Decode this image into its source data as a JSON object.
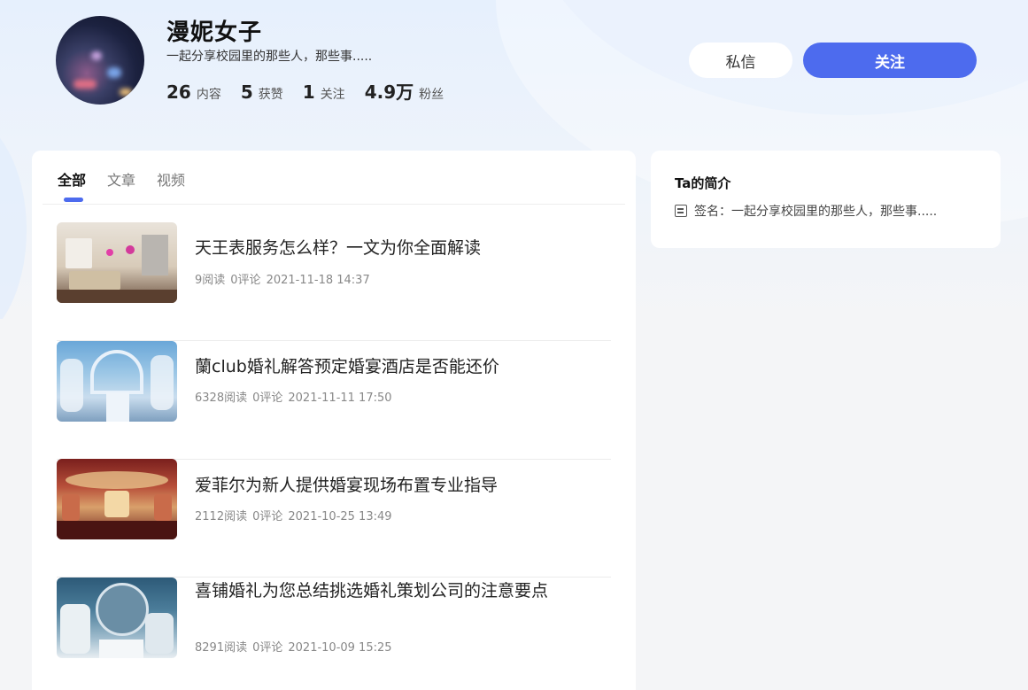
{
  "profile": {
    "name": "漫妮女子",
    "bio": "一起分享校园里的那些人，那些事.....",
    "stats": [
      {
        "num": "26",
        "label": "内容"
      },
      {
        "num": "5",
        "label": "获赞"
      },
      {
        "num": "1",
        "label": "关注"
      },
      {
        "num": "4.9万",
        "label": "粉丝"
      }
    ]
  },
  "actions": {
    "message_label": "私信",
    "follow_label": "关注",
    "follow_color": "#4d6bee"
  },
  "tabs": [
    {
      "label": "全部",
      "active": true
    },
    {
      "label": "文章",
      "active": false
    },
    {
      "label": "视频",
      "active": false
    }
  ],
  "articles": [
    {
      "title": "天王表服务怎么样？一文为你全面解读",
      "reads": "9阅读",
      "comments": "0评论",
      "date": "2021-11-18 14:37"
    },
    {
      "title": "蘭club婚礼解答预定婚宴酒店是否能还价",
      "reads": "6328阅读",
      "comments": "0评论",
      "date": "2021-11-11 17:50"
    },
    {
      "title": "爱菲尔为新人提供婚宴现场布置专业指导",
      "reads": "2112阅读",
      "comments": "0评论",
      "date": "2021-10-25 13:49"
    },
    {
      "title": "喜铺婚礼为您总结挑选婚礼策划公司的注意要点",
      "reads": "8291阅读",
      "comments": "0评论",
      "date": "2021-10-09 15:25"
    }
  ],
  "intro": {
    "title": "Ta的简介",
    "sign_label": "签名：",
    "sign_text": "一起分享校园里的那些人，那些事....."
  }
}
